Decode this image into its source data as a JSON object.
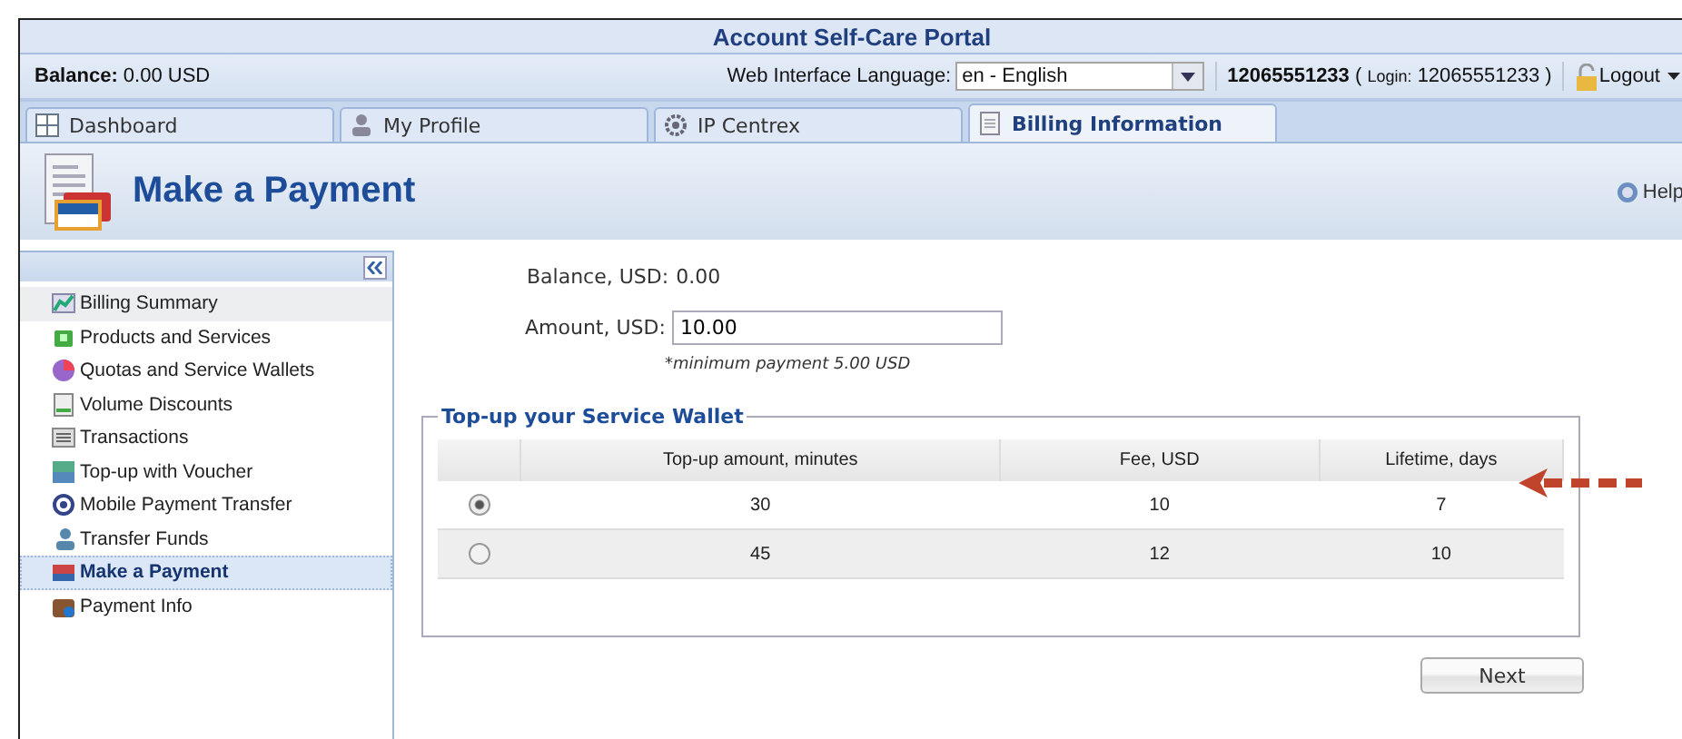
{
  "window": {
    "title": "Account Self-Care Portal"
  },
  "info_bar": {
    "balance_label": "Balance:",
    "balance_value": "0.00 USD",
    "language_label": "Web Interface Language:",
    "language_value": "en - English",
    "user": "12065551233",
    "login_open": "(",
    "login_label": "Login:",
    "login_value": "12065551233",
    "login_close": ")",
    "logout": "Logout"
  },
  "tabs": [
    {
      "label": "Dashboard",
      "selected": false
    },
    {
      "label": "My Profile",
      "selected": false
    },
    {
      "label": "IP Centrex",
      "selected": false
    },
    {
      "label": "Billing Information",
      "selected": true
    }
  ],
  "header": {
    "title": "Make a Payment",
    "help": "Help"
  },
  "sidebar": {
    "items": [
      {
        "label": "Billing Summary",
        "selected": false,
        "hovered": true
      },
      {
        "label": "Products and Services",
        "selected": false,
        "hovered": false
      },
      {
        "label": "Quotas and Service Wallets",
        "selected": false,
        "hovered": false
      },
      {
        "label": "Volume Discounts",
        "selected": false,
        "hovered": false
      },
      {
        "label": "Transactions",
        "selected": false,
        "hovered": false
      },
      {
        "label": "Top-up with Voucher",
        "selected": false,
        "hovered": false
      },
      {
        "label": "Mobile Payment Transfer",
        "selected": false,
        "hovered": false
      },
      {
        "label": "Transfer Funds",
        "selected": false,
        "hovered": false
      },
      {
        "label": "Make a Payment",
        "selected": true,
        "hovered": false
      },
      {
        "label": "Payment Info",
        "selected": false,
        "hovered": false
      }
    ]
  },
  "form": {
    "balance_label": "Balance, USD:",
    "balance_value": "0.00",
    "amount_label": "Amount, USD:",
    "amount_value": "10.00",
    "note": "*minimum payment 5.00 USD"
  },
  "wallet": {
    "legend": "Top-up your Service Wallet",
    "columns": [
      "Top-up amount, minutes",
      "Fee, USD",
      "Lifetime, days"
    ],
    "rows": [
      {
        "selected": true,
        "cells": [
          "30",
          "10",
          "7"
        ]
      },
      {
        "selected": false,
        "cells": [
          "45",
          "12",
          "10"
        ]
      }
    ]
  },
  "buttons": [
    "Next"
  ]
}
